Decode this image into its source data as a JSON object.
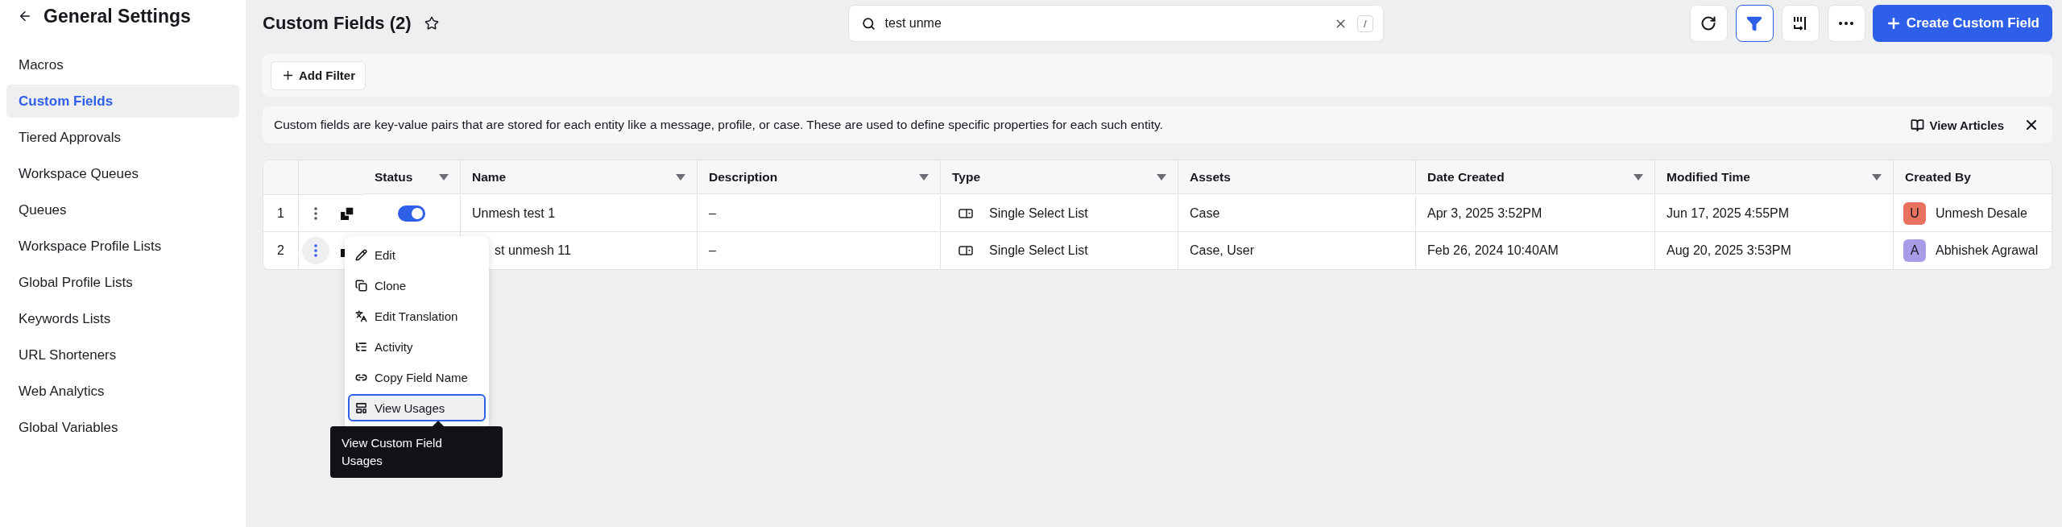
{
  "sidebar": {
    "title": "General Settings",
    "items": [
      {
        "label": "Macros",
        "selected": false
      },
      {
        "label": "Custom Fields",
        "selected": true
      },
      {
        "label": "Tiered Approvals",
        "selected": false
      },
      {
        "label": "Workspace Queues",
        "selected": false
      },
      {
        "label": "Queues",
        "selected": false
      },
      {
        "label": "Workspace Profile Lists",
        "selected": false
      },
      {
        "label": "Global Profile Lists",
        "selected": false
      },
      {
        "label": "Keywords Lists",
        "selected": false
      },
      {
        "label": "URL Shorteners",
        "selected": false
      },
      {
        "label": "Web Analytics",
        "selected": false
      },
      {
        "label": "Global Variables",
        "selected": false
      }
    ]
  },
  "header": {
    "title": "Custom Fields (2)",
    "search": {
      "value": "test unme",
      "shortcut": "/"
    },
    "create_button": "Create Custom Field",
    "filter_active": true
  },
  "filter_bar": {
    "add_filter": "Add Filter"
  },
  "info_bar": {
    "text": "Custom fields are key-value pairs that are stored for each entity like a message, profile, or case. These are used to define specific properties for each such entity.",
    "link": "View Articles"
  },
  "table": {
    "columns": [
      {
        "label": "Status",
        "menu": true
      },
      {
        "label": "Name",
        "menu": true
      },
      {
        "label": "Description",
        "menu": true
      },
      {
        "label": "Type",
        "menu": true
      },
      {
        "label": "Assets",
        "menu": false
      },
      {
        "label": "Date Created",
        "menu": true
      },
      {
        "label": "Modified Time",
        "menu": true
      },
      {
        "label": "Created By",
        "menu": false
      }
    ],
    "rows": [
      {
        "index": "1",
        "menu_open": false,
        "on": true,
        "name": "Unmesh test 1",
        "name_covered": false,
        "description": "–",
        "type": "Single Select List",
        "assets": "Case",
        "date_created": "Apr 3, 2025 3:52PM",
        "modified": "Jun 17, 2025 4:55PM",
        "creator": {
          "initial": "U",
          "name": "Unmesh Desale",
          "color": "#e8725f"
        }
      },
      {
        "index": "2",
        "menu_open": true,
        "name": "st unmesh 11",
        "name_covered": true,
        "description": "–",
        "type": "Single Select List",
        "assets": "Case, User",
        "date_created": "Feb 26, 2024 10:40AM",
        "modified": "Aug 20, 2025 3:53PM",
        "creator": {
          "initial": "A",
          "name": "Abhishek Agrawal",
          "color": "#a99be8"
        }
      }
    ]
  },
  "row_menu": {
    "items": [
      {
        "kind": "edit",
        "label": "Edit",
        "selected": false
      },
      {
        "kind": "clone",
        "label": "Clone",
        "selected": false
      },
      {
        "kind": "translate",
        "label": "Edit Translation",
        "selected": false
      },
      {
        "kind": "activity",
        "label": "Activity",
        "selected": false
      },
      {
        "kind": "link",
        "label": "Copy Field Name",
        "selected": false
      },
      {
        "kind": "usages",
        "label": "View Usages",
        "selected": true
      }
    ],
    "tooltip": "View Custom Field Usages"
  }
}
